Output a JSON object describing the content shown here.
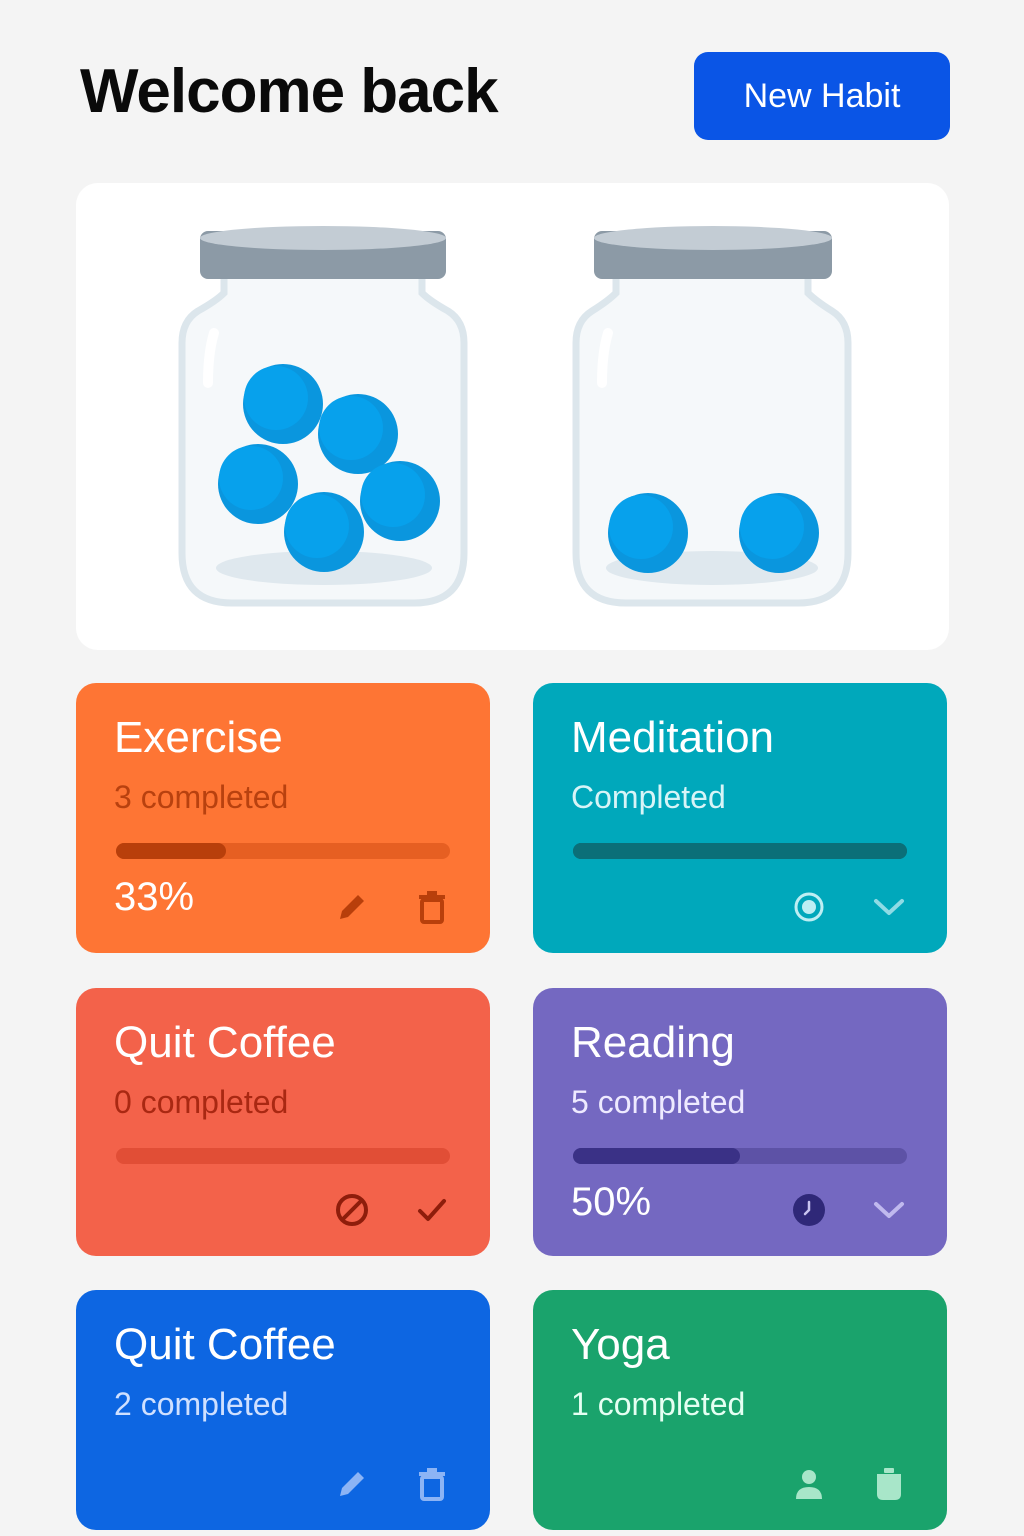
{
  "header": {
    "title": "Welcome back",
    "new_habit_label": "New Habit"
  },
  "jars": [
    {
      "name": "jar-left",
      "marble_count": 5
    },
    {
      "name": "jar-right",
      "marble_count": 2
    }
  ],
  "colors": {
    "accent": "#0a55e6",
    "marble": "#0aa0ea",
    "exercise": "#fe7534",
    "meditation": "#00a8bb",
    "quit_coffee_red": "#f3624a",
    "reading": "#7468c1",
    "quit_coffee_blue": "#0d66e2",
    "yoga": "#1aa36c"
  },
  "habits": [
    {
      "name": "Exercise",
      "status": "3 completed",
      "progress": 0.33,
      "progress_label": "33%",
      "icons": [
        "pencil-icon",
        "trash-icon"
      ]
    },
    {
      "name": "Meditation",
      "status": "Completed",
      "progress": 1.0,
      "progress_label": "",
      "icons": [
        "circle-icon",
        "chevron-down-icon"
      ]
    },
    {
      "name": "Quit Coffee",
      "status": "0 completed",
      "progress": 0.0,
      "progress_label": "",
      "icons": [
        "ban-icon",
        "check-icon"
      ]
    },
    {
      "name": "Reading",
      "status": "5 completed",
      "progress": 0.5,
      "progress_label": "50%",
      "icons": [
        "clock-icon",
        "chevron-down-icon"
      ]
    },
    {
      "name": "Quit Coffee",
      "status": "2 completed",
      "progress": null,
      "progress_label": "",
      "icons": [
        "pencil-icon",
        "trash-icon"
      ]
    },
    {
      "name": "Yoga",
      "status": "1 completed",
      "progress": null,
      "progress_label": "",
      "icons": [
        "person-icon",
        "cup-icon"
      ]
    }
  ]
}
